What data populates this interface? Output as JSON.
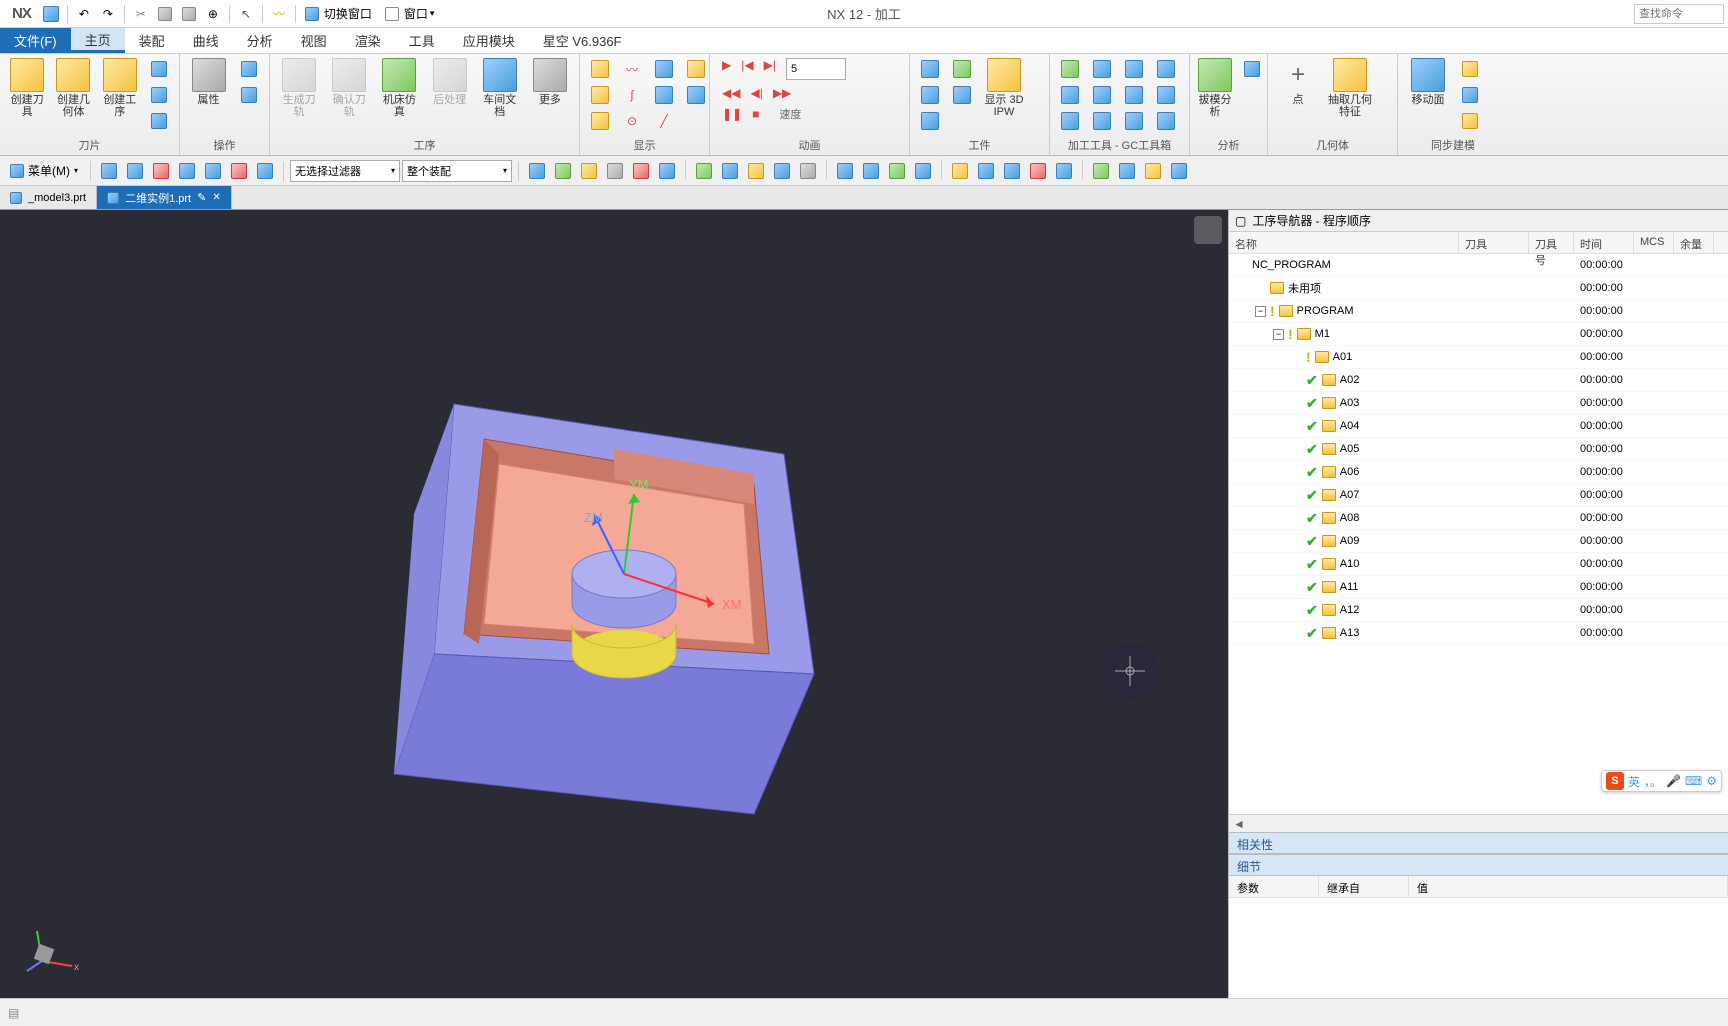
{
  "app": {
    "title": "NX 12 - 加工",
    "logo": "NX",
    "search_placeholder": "查找命令"
  },
  "qat": {
    "save": "保存",
    "undo": "撤销",
    "redo": "重做",
    "switch_window_label": "切换窗口",
    "window_label": "窗口"
  },
  "menu": {
    "file": "文件(F)",
    "tabs": [
      "主页",
      "装配",
      "曲线",
      "分析",
      "视图",
      "渲染",
      "工具",
      "应用模块",
      "星空 V6.936F"
    ],
    "active_index": 0
  },
  "ribbon": {
    "groups": [
      {
        "label": "刀片",
        "buttons": [
          {
            "lbl": "创建刀具"
          },
          {
            "lbl": "创建几何体"
          },
          {
            "lbl": "创建工序"
          }
        ]
      },
      {
        "label": "操作",
        "buttons": [
          {
            "lbl": "属性"
          }
        ]
      },
      {
        "label": "工序",
        "buttons": [
          {
            "lbl": "生成刀轨",
            "disabled": true
          },
          {
            "lbl": "确认刀轨",
            "disabled": true
          },
          {
            "lbl": "机床仿真"
          },
          {
            "lbl": "后处理",
            "disabled": true
          },
          {
            "lbl": "车间文档"
          },
          {
            "lbl": "更多"
          }
        ]
      },
      {
        "label": "显示",
        "buttons": []
      },
      {
        "label": "动画",
        "speed_value": "5",
        "speed_label": "速度"
      },
      {
        "label": "工件",
        "buttons": [
          {
            "lbl": "显示 3D IPW"
          }
        ]
      },
      {
        "label": "加工工具 - GC工具箱",
        "buttons": []
      },
      {
        "label": "分析",
        "buttons": [
          {
            "lbl": "拔模分析"
          }
        ]
      },
      {
        "label": "几何体",
        "buttons": [
          {
            "lbl": "点"
          },
          {
            "lbl": "抽取几何特征"
          }
        ]
      },
      {
        "label": "同步建模",
        "buttons": [
          {
            "lbl": "移动面"
          }
        ]
      }
    ]
  },
  "toolbar2": {
    "menu_label": "菜单(M)",
    "filter_combo": "无选择过滤器",
    "assembly_combo": "整个装配"
  },
  "doctabs": [
    {
      "label": "_model3.prt",
      "active": false
    },
    {
      "label": "二维实例1.prt",
      "active": true
    }
  ],
  "viewport": {
    "axes": {
      "x": "XM",
      "y": "YM",
      "z": "ZM"
    }
  },
  "navigator": {
    "title": "工序导航器 - 程序顺序",
    "columns": {
      "name": "名称",
      "tool": "刀具",
      "toolno": "刀具号",
      "time": "时间",
      "mcs": "MCS",
      "rest": "余量"
    },
    "root": {
      "name": "NC_PROGRAM",
      "time": "00:00:00"
    },
    "unused": {
      "name": "未用项",
      "time": "00:00:00"
    },
    "program": {
      "name": "PROGRAM",
      "time": "00:00:00",
      "status": "warn"
    },
    "m1": {
      "name": "M1",
      "time": "00:00:00",
      "status": "warn"
    },
    "ops": [
      {
        "name": "A01",
        "time": "00:00:00",
        "status": "warn"
      },
      {
        "name": "A02",
        "time": "00:00:00",
        "status": "check"
      },
      {
        "name": "A03",
        "time": "00:00:00",
        "status": "check"
      },
      {
        "name": "A04",
        "time": "00:00:00",
        "status": "check"
      },
      {
        "name": "A05",
        "time": "00:00:00",
        "status": "check"
      },
      {
        "name": "A06",
        "time": "00:00:00",
        "status": "check"
      },
      {
        "name": "A07",
        "time": "00:00:00",
        "status": "check"
      },
      {
        "name": "A08",
        "time": "00:00:00",
        "status": "check"
      },
      {
        "name": "A09",
        "time": "00:00:00",
        "status": "check"
      },
      {
        "name": "A10",
        "time": "00:00:00",
        "status": "check"
      },
      {
        "name": "A11",
        "time": "00:00:00",
        "status": "check"
      },
      {
        "name": "A12",
        "time": "00:00:00",
        "status": "check"
      },
      {
        "name": "A13",
        "time": "00:00:00",
        "status": "check"
      }
    ],
    "related_section": "相关性",
    "details_section": "细节",
    "details_cols": {
      "param": "参数",
      "inherit": "继承自",
      "value": "值"
    }
  },
  "ime": {
    "lang": "英",
    "dots": "，。"
  }
}
